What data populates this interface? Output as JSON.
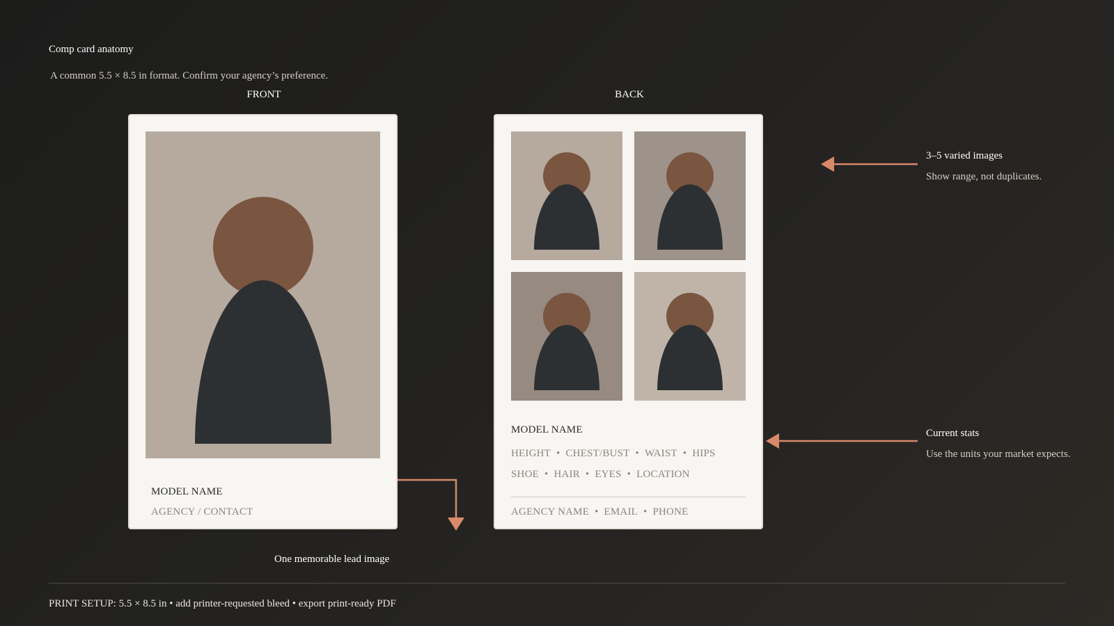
{
  "header": {
    "title": "Comp card anatomy",
    "subtitle": "A common 5.5 × 8.5 in format. Confirm your agency’s preference."
  },
  "front": {
    "label": "FRONT",
    "model_name": "MODEL NAME",
    "contact": "AGENCY / CONTACT"
  },
  "back": {
    "label": "BACK",
    "model_name": "MODEL NAME",
    "stats_line1": [
      "HEIGHT",
      "CHEST/BUST",
      "WAIST",
      "HIPS"
    ],
    "stats_line2": [
      "SHOE",
      "HAIR",
      "EYES",
      "LOCATION"
    ],
    "contact_line": [
      "AGENCY NAME",
      "EMAIL",
      "PHONE"
    ],
    "separator": "•"
  },
  "annotations": {
    "images_title": "3–5 varied images",
    "images_desc": "Show range, not duplicates.",
    "stats_title": "Current stats",
    "stats_desc": "Use the units your market expects.",
    "lead_image": "One memorable lead image"
  },
  "footer": {
    "print_setup": "PRINT SETUP: 5.5 × 8.5 in • add printer-requested bleed • export print-ready PDF"
  },
  "colors": {
    "accent": "#d9896a",
    "card": "#f8f6f2",
    "skin": "#7a5540",
    "garment": "#2d3032"
  }
}
